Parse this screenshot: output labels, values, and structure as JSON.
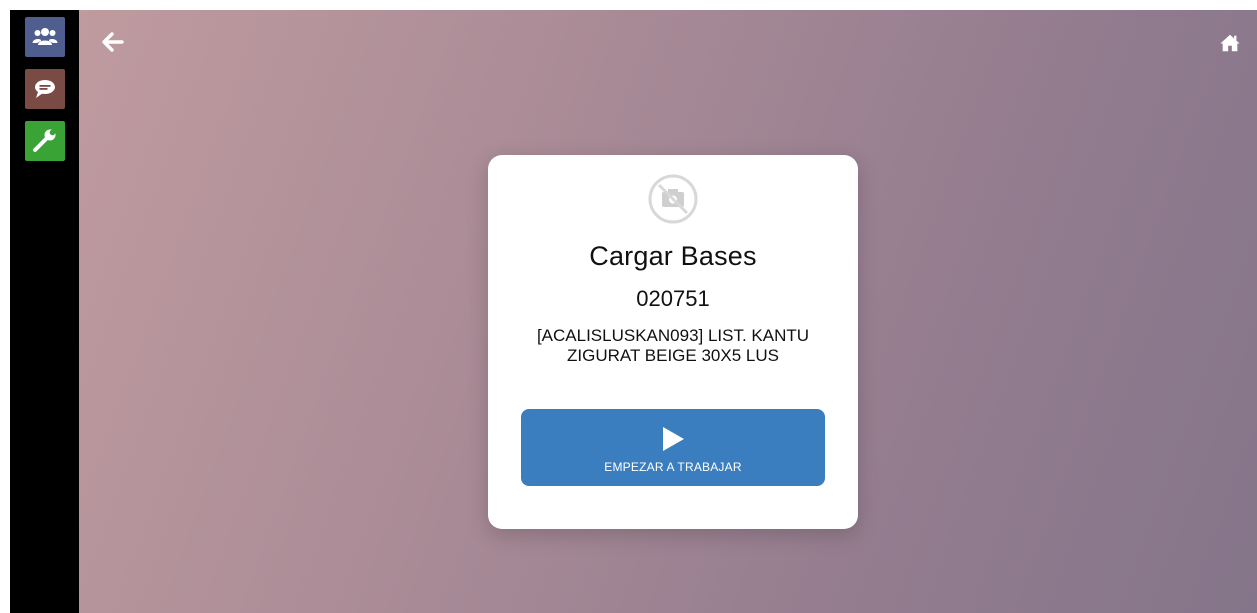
{
  "sidebar": {
    "items": [
      {
        "icon": "users-icon",
        "bg": "#4f5d8f"
      },
      {
        "icon": "chat-icon",
        "bg": "#7a4a45"
      },
      {
        "icon": "wrench-icon",
        "bg": "#3aa335"
      }
    ]
  },
  "header": {
    "back_icon": "arrow-left-icon",
    "home_icon": "home-icon"
  },
  "card": {
    "image_icon": "no-camera-icon",
    "title": "Cargar Bases",
    "code": "020751",
    "description": "[ACALISLUSKAN093] LIST. KANTU ZIGURAT BEIGE 30X5 LUS",
    "start_button": {
      "icon": "play-icon",
      "label": "EMPEZAR A TRABAJAR",
      "color": "#3a7ec0"
    }
  }
}
